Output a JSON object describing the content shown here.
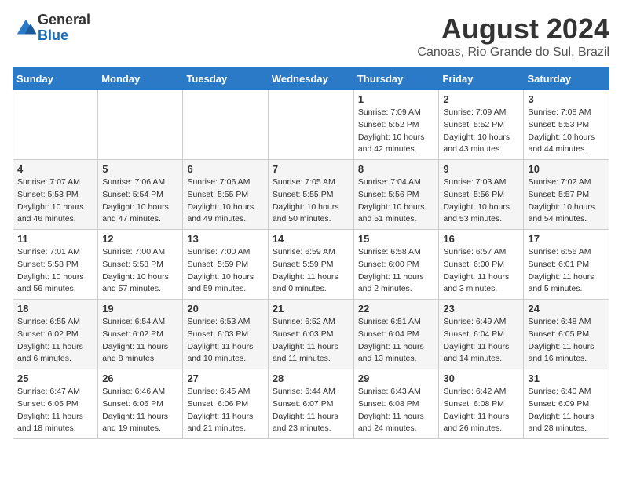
{
  "logo": {
    "general": "General",
    "blue": "Blue"
  },
  "title": {
    "month_year": "August 2024",
    "location": "Canoas, Rio Grande do Sul, Brazil"
  },
  "calendar": {
    "headers": [
      "Sunday",
      "Monday",
      "Tuesday",
      "Wednesday",
      "Thursday",
      "Friday",
      "Saturday"
    ],
    "weeks": [
      [
        {
          "day": "",
          "info": ""
        },
        {
          "day": "",
          "info": ""
        },
        {
          "day": "",
          "info": ""
        },
        {
          "day": "",
          "info": ""
        },
        {
          "day": "1",
          "info": "Sunrise: 7:09 AM\nSunset: 5:52 PM\nDaylight: 10 hours\nand 42 minutes."
        },
        {
          "day": "2",
          "info": "Sunrise: 7:09 AM\nSunset: 5:52 PM\nDaylight: 10 hours\nand 43 minutes."
        },
        {
          "day": "3",
          "info": "Sunrise: 7:08 AM\nSunset: 5:53 PM\nDaylight: 10 hours\nand 44 minutes."
        }
      ],
      [
        {
          "day": "4",
          "info": "Sunrise: 7:07 AM\nSunset: 5:53 PM\nDaylight: 10 hours\nand 46 minutes."
        },
        {
          "day": "5",
          "info": "Sunrise: 7:06 AM\nSunset: 5:54 PM\nDaylight: 10 hours\nand 47 minutes."
        },
        {
          "day": "6",
          "info": "Sunrise: 7:06 AM\nSunset: 5:55 PM\nDaylight: 10 hours\nand 49 minutes."
        },
        {
          "day": "7",
          "info": "Sunrise: 7:05 AM\nSunset: 5:55 PM\nDaylight: 10 hours\nand 50 minutes."
        },
        {
          "day": "8",
          "info": "Sunrise: 7:04 AM\nSunset: 5:56 PM\nDaylight: 10 hours\nand 51 minutes."
        },
        {
          "day": "9",
          "info": "Sunrise: 7:03 AM\nSunset: 5:56 PM\nDaylight: 10 hours\nand 53 minutes."
        },
        {
          "day": "10",
          "info": "Sunrise: 7:02 AM\nSunset: 5:57 PM\nDaylight: 10 hours\nand 54 minutes."
        }
      ],
      [
        {
          "day": "11",
          "info": "Sunrise: 7:01 AM\nSunset: 5:58 PM\nDaylight: 10 hours\nand 56 minutes."
        },
        {
          "day": "12",
          "info": "Sunrise: 7:00 AM\nSunset: 5:58 PM\nDaylight: 10 hours\nand 57 minutes."
        },
        {
          "day": "13",
          "info": "Sunrise: 7:00 AM\nSunset: 5:59 PM\nDaylight: 10 hours\nand 59 minutes."
        },
        {
          "day": "14",
          "info": "Sunrise: 6:59 AM\nSunset: 5:59 PM\nDaylight: 11 hours\nand 0 minutes."
        },
        {
          "day": "15",
          "info": "Sunrise: 6:58 AM\nSunset: 6:00 PM\nDaylight: 11 hours\nand 2 minutes."
        },
        {
          "day": "16",
          "info": "Sunrise: 6:57 AM\nSunset: 6:00 PM\nDaylight: 11 hours\nand 3 minutes."
        },
        {
          "day": "17",
          "info": "Sunrise: 6:56 AM\nSunset: 6:01 PM\nDaylight: 11 hours\nand 5 minutes."
        }
      ],
      [
        {
          "day": "18",
          "info": "Sunrise: 6:55 AM\nSunset: 6:02 PM\nDaylight: 11 hours\nand 6 minutes."
        },
        {
          "day": "19",
          "info": "Sunrise: 6:54 AM\nSunset: 6:02 PM\nDaylight: 11 hours\nand 8 minutes."
        },
        {
          "day": "20",
          "info": "Sunrise: 6:53 AM\nSunset: 6:03 PM\nDaylight: 11 hours\nand 10 minutes."
        },
        {
          "day": "21",
          "info": "Sunrise: 6:52 AM\nSunset: 6:03 PM\nDaylight: 11 hours\nand 11 minutes."
        },
        {
          "day": "22",
          "info": "Sunrise: 6:51 AM\nSunset: 6:04 PM\nDaylight: 11 hours\nand 13 minutes."
        },
        {
          "day": "23",
          "info": "Sunrise: 6:49 AM\nSunset: 6:04 PM\nDaylight: 11 hours\nand 14 minutes."
        },
        {
          "day": "24",
          "info": "Sunrise: 6:48 AM\nSunset: 6:05 PM\nDaylight: 11 hours\nand 16 minutes."
        }
      ],
      [
        {
          "day": "25",
          "info": "Sunrise: 6:47 AM\nSunset: 6:05 PM\nDaylight: 11 hours\nand 18 minutes."
        },
        {
          "day": "26",
          "info": "Sunrise: 6:46 AM\nSunset: 6:06 PM\nDaylight: 11 hours\nand 19 minutes."
        },
        {
          "day": "27",
          "info": "Sunrise: 6:45 AM\nSunset: 6:06 PM\nDaylight: 11 hours\nand 21 minutes."
        },
        {
          "day": "28",
          "info": "Sunrise: 6:44 AM\nSunset: 6:07 PM\nDaylight: 11 hours\nand 23 minutes."
        },
        {
          "day": "29",
          "info": "Sunrise: 6:43 AM\nSunset: 6:08 PM\nDaylight: 11 hours\nand 24 minutes."
        },
        {
          "day": "30",
          "info": "Sunrise: 6:42 AM\nSunset: 6:08 PM\nDaylight: 11 hours\nand 26 minutes."
        },
        {
          "day": "31",
          "info": "Sunrise: 6:40 AM\nSunset: 6:09 PM\nDaylight: 11 hours\nand 28 minutes."
        }
      ]
    ]
  }
}
